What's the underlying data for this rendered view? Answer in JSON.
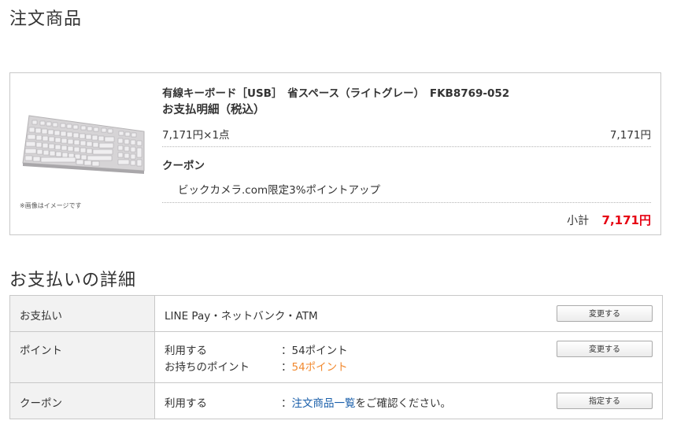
{
  "headings": {
    "order_items": "注文商品",
    "payment_details": "お支払いの詳細"
  },
  "product": {
    "image_note": "※画像はイメージです",
    "name": "有線キーボード［USB］　省スペース（ライトグレー）　FKB8769-052",
    "payment_breakdown_title": "お支払明細（税込）",
    "qty_text": "7,171円×1点",
    "line_price": "7,171円",
    "coupon_title": "クーポン",
    "coupon_item": "ビックカメラ.com限定3%ポイントアップ",
    "subtotal_label": "小計",
    "subtotal_value": "7,171円"
  },
  "payment_table": {
    "payment": {
      "label": "お支払い",
      "value": "LINE Pay・ネットバンク・ATM",
      "button": "変更する"
    },
    "points": {
      "label": "ポイント",
      "use_label": "利用する",
      "use_value": "：54ポイント",
      "held_label": "お持ちのポイント",
      "held_colon": "：",
      "held_value": "54ポイント",
      "button": "変更する"
    },
    "coupon": {
      "label": "クーポン",
      "use_label": "利用する",
      "colon": "：",
      "link_text": "注文商品一覧",
      "suffix": "をご確認ください。",
      "button": "指定する"
    }
  },
  "colors": {
    "price_red": "#e60012",
    "points_orange": "#f28a30",
    "link_blue": "#1a5faa"
  }
}
